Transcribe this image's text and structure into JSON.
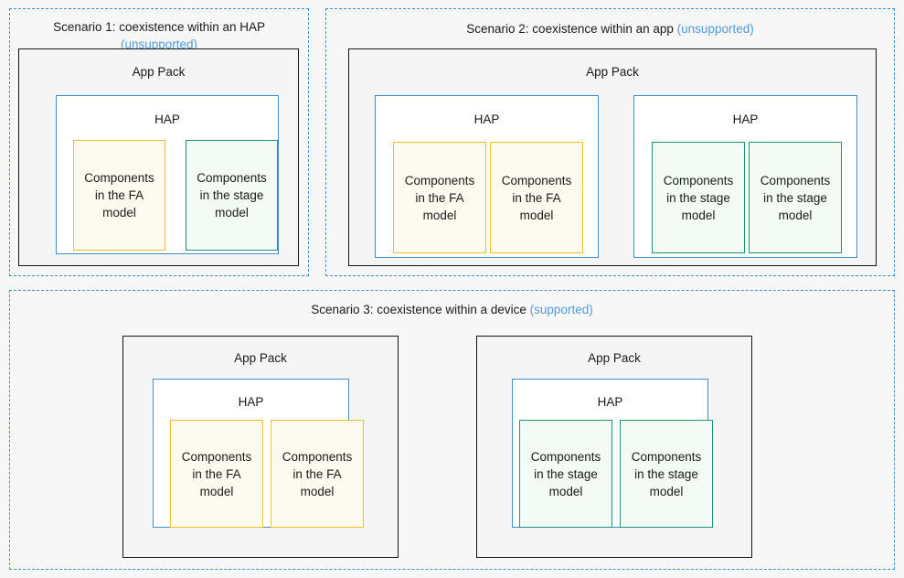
{
  "colors": {
    "page_background": "#f7f7f7",
    "dashed_frame": "#3d8fd1",
    "app_pack_border": "#141414",
    "app_pack_fill": "#f5f5f5",
    "hap_border": "#3d8fd1",
    "hap_fill": "#ffffff",
    "fa_border": "#f2bf1c",
    "fa_fill": "#fdfbef",
    "stage_border": "#1a9381",
    "stage_fill": "#f4fbf5",
    "status_note": "#4f9ae0",
    "text": "#1a1a1a"
  },
  "labels": {
    "app_pack": "App Pack",
    "hap": "HAP",
    "fa_component": "Components\nin the FA\nmodel",
    "stage_component": "Components\nin the stage\nmodel"
  },
  "scenarios": [
    {
      "id": "scenario-1",
      "title_main": "Scenario 1: coexistence within an HAP",
      "status": "(unsupported)",
      "supported": false,
      "app_packs": [
        {
          "label": "App Pack",
          "haps": [
            {
              "label": "HAP",
              "components": [
                {
                  "type": "fa",
                  "text": "Components\nin the FA\nmodel"
                },
                {
                  "type": "stage",
                  "text": "Components\nin the stage\nmodel"
                }
              ]
            }
          ]
        }
      ]
    },
    {
      "id": "scenario-2",
      "title_main": "Scenario 2: coexistence within an app",
      "status": "(unsupported)",
      "supported": false,
      "app_packs": [
        {
          "label": "App Pack",
          "haps": [
            {
              "label": "HAP",
              "components": [
                {
                  "type": "fa",
                  "text": "Components\nin the FA\nmodel"
                },
                {
                  "type": "fa",
                  "text": "Components\nin the FA\nmodel"
                }
              ]
            },
            {
              "label": "HAP",
              "components": [
                {
                  "type": "stage",
                  "text": "Components\nin the stage\nmodel"
                },
                {
                  "type": "stage",
                  "text": "Components\nin the stage\nmodel"
                }
              ]
            }
          ]
        }
      ]
    },
    {
      "id": "scenario-3",
      "title_main": "Scenario 3: coexistence within a device",
      "status": "(supported)",
      "supported": true,
      "app_packs": [
        {
          "label": "App Pack",
          "haps": [
            {
              "label": "HAP",
              "components": [
                {
                  "type": "fa",
                  "text": "Components\nin the FA\nmodel"
                },
                {
                  "type": "fa",
                  "text": "Components\nin the FA\nmodel"
                }
              ]
            }
          ]
        },
        {
          "label": "App Pack",
          "haps": [
            {
              "label": "HAP",
              "components": [
                {
                  "type": "stage",
                  "text": "Components\nin the stage\nmodel"
                },
                {
                  "type": "stage",
                  "text": "Components\nin the stage\nmodel"
                }
              ]
            }
          ]
        }
      ]
    }
  ]
}
